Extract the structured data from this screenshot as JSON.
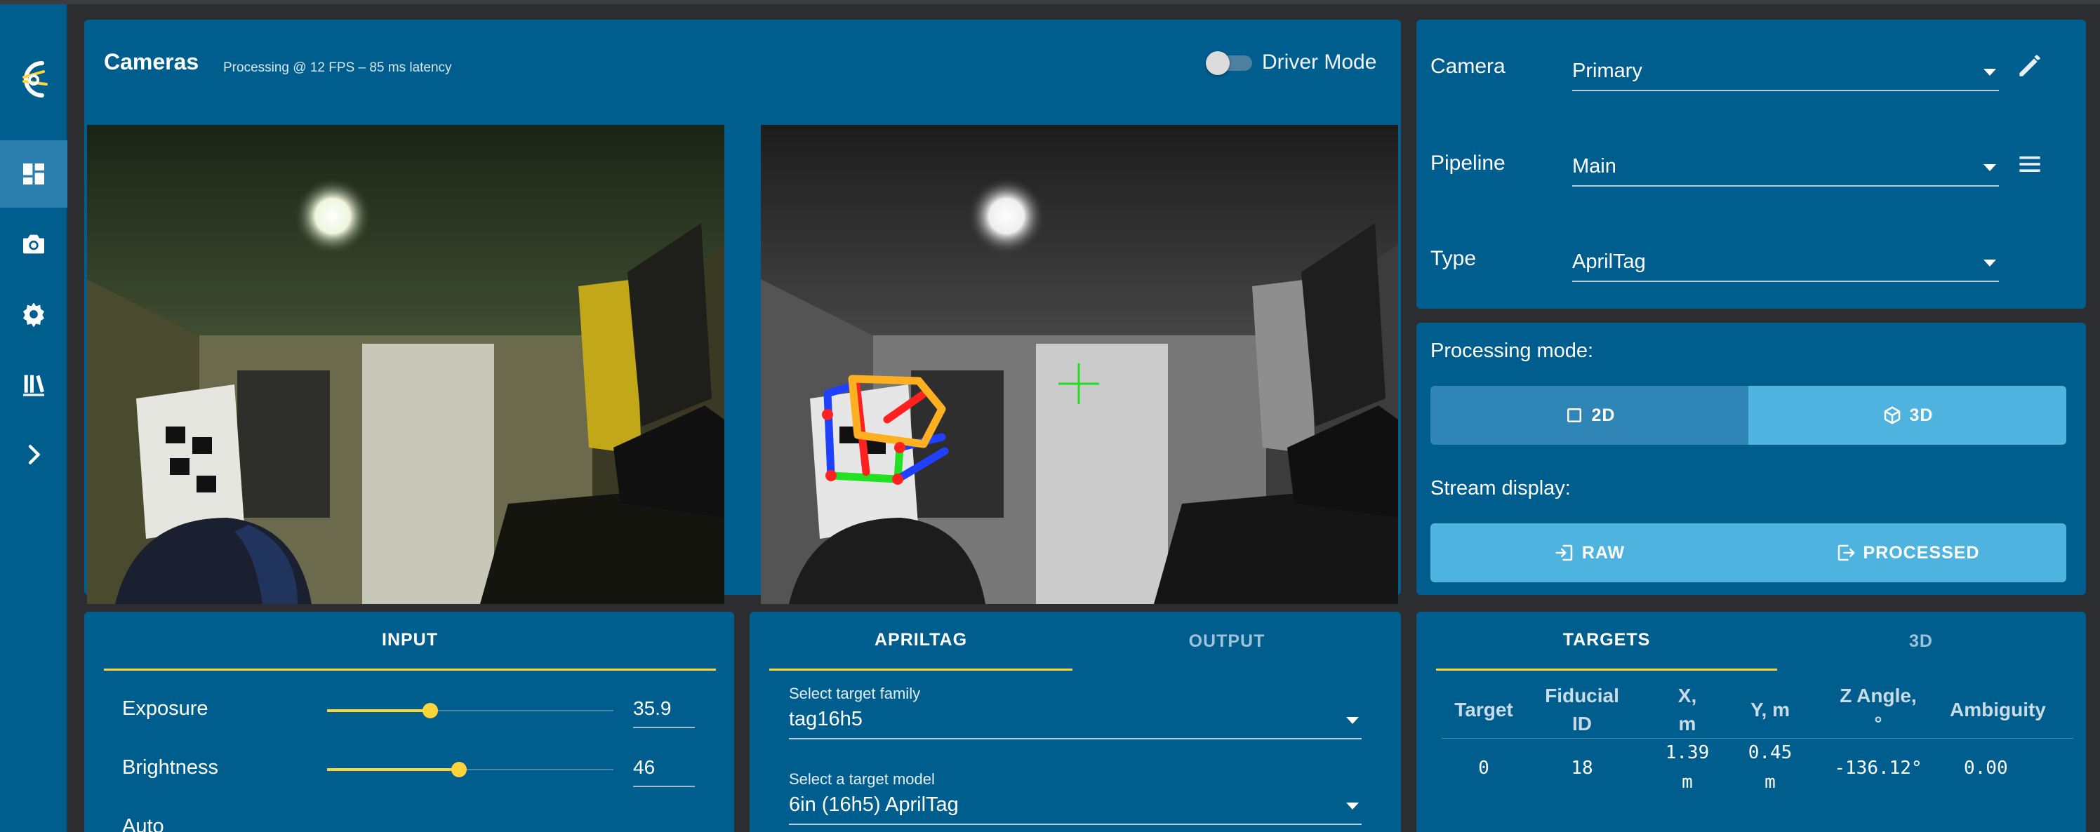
{
  "nav": {
    "items": [
      {
        "icon": "dashboard-icon",
        "active": true
      },
      {
        "icon": "camera-icon",
        "active": false
      },
      {
        "icon": "gear-icon",
        "active": false
      },
      {
        "icon": "docs-icon",
        "active": false
      },
      {
        "icon": "chevron-right-icon",
        "active": false
      }
    ]
  },
  "cameras": {
    "title": "Cameras",
    "status": "Processing @ 12 FPS – 85 ms latency",
    "driver_mode_label": "Driver Mode",
    "driver_mode_on": false
  },
  "config": {
    "camera_label": "Camera",
    "camera_value": "Primary",
    "pipeline_label": "Pipeline",
    "pipeline_value": "Main",
    "type_label": "Type",
    "type_value": "AprilTag"
  },
  "modes": {
    "processing_label": "Processing mode:",
    "processing_options": [
      "2D",
      "3D"
    ],
    "processing_selected": "3D",
    "stream_label": "Stream display:",
    "stream_options": [
      "RAW",
      "PROCESSED"
    ]
  },
  "input": {
    "tab": "INPUT",
    "exposure_label": "Exposure",
    "exposure_value": "35.9",
    "exposure_fraction": 0.36,
    "brightness_label": "Brightness",
    "brightness_value": "46",
    "brightness_fraction": 0.46,
    "auto_label": "Auto"
  },
  "apriltag": {
    "tabs": [
      "APRILTAG",
      "OUTPUT"
    ],
    "family_label": "Select target family",
    "family_value": "tag16h5",
    "model_label": "Select a target model",
    "model_value": "6in (16h5) AprilTag"
  },
  "targets": {
    "tabs": [
      "TARGETS",
      "3D"
    ],
    "headers": [
      [
        "Target"
      ],
      [
        "Fiducial",
        "ID"
      ],
      [
        "X,",
        "m"
      ],
      [
        "Y, m"
      ],
      [
        "Z Angle,",
        "°"
      ],
      [
        "Ambiguity"
      ]
    ],
    "rows": [
      {
        "target": "0",
        "fiducial_id": "18",
        "x": [
          "1.39",
          "m"
        ],
        "y": [
          "0.45",
          "m"
        ],
        "z_angle": "-136.12°",
        "ambiguity": "0.00"
      }
    ]
  },
  "colors": {
    "panel": "#005e8f",
    "accent": "#ffd43b",
    "toggle_selected": "#4fb3e0",
    "toggle_unselected": "#2f86b6",
    "background": "#2b2d31"
  }
}
